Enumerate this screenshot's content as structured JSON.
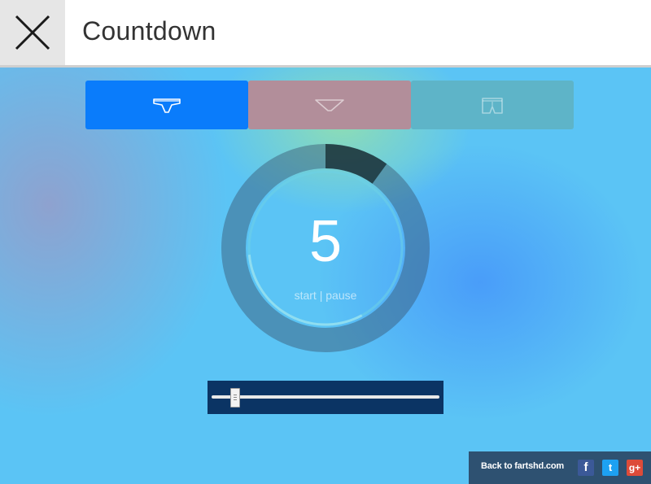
{
  "header": {
    "title": "Countdown",
    "close_icon": "close-x-icon"
  },
  "fart_types": [
    {
      "name": "briefs-icon",
      "color": "#0a7cfb",
      "selected": true
    },
    {
      "name": "thong-icon",
      "color": "#b28e9a",
      "selected": false
    },
    {
      "name": "boxers-icon",
      "color": "#5eb4c8",
      "selected": false
    }
  ],
  "timer": {
    "count": "5",
    "start_label": "start",
    "separator": " | ",
    "pause_label": "pause",
    "progress_fraction": 0.1,
    "inner_progress_fraction": 0.75
  },
  "slider": {
    "value_fraction": 0.1
  },
  "footer": {
    "back_link": "Back to fartshd.com",
    "facebook": "f",
    "twitter": "t",
    "google_plus": "g+",
    "colors": {
      "facebook": "#3b5998",
      "twitter": "#1da1f2",
      "google_plus": "#dd4b39"
    }
  }
}
